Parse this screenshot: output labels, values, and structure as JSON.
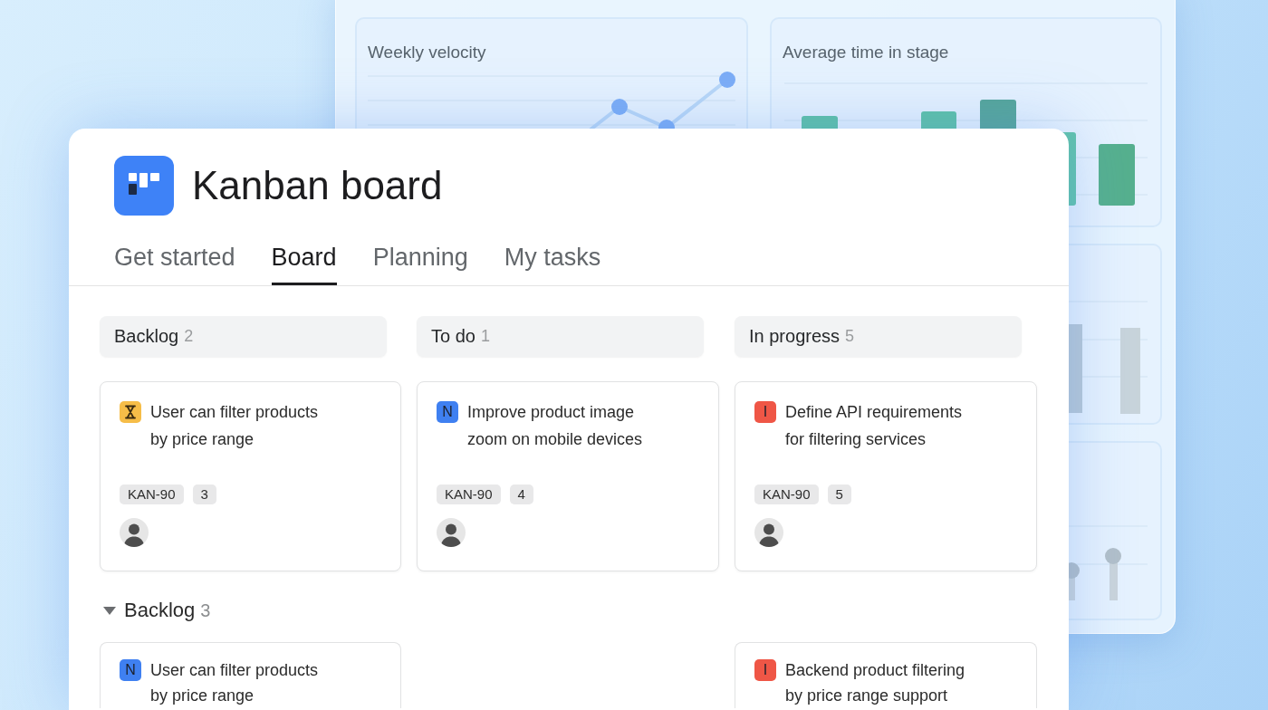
{
  "dashboard": {
    "charts": [
      {
        "kind": "line",
        "title": "Weekly velocity"
      },
      {
        "kind": "bar",
        "title": "Average time in stage"
      },
      {
        "kind": "column"
      },
      {
        "kind": "lollipop"
      }
    ]
  },
  "board": {
    "title": "Kanban board",
    "tabs": [
      {
        "label": "Get started",
        "selected": false
      },
      {
        "label": "Board",
        "selected": true
      },
      {
        "label": "Planning",
        "selected": false
      },
      {
        "label": "My tasks",
        "selected": false
      }
    ],
    "columns": [
      {
        "title": "Backlog",
        "count": "2"
      },
      {
        "title": "To do",
        "count": "1"
      },
      {
        "title": "In progress",
        "count": "5"
      }
    ],
    "lanes": [
      {
        "cells": [
          {
            "cards": [
              {
                "type": {
                  "kind": "hourglass",
                  "color": "#f6bd48"
                },
                "title": "User can filter products by price range",
                "key": "KAN-90",
                "points": "3",
                "avatar": true
              }
            ]
          },
          {
            "cards": [
              {
                "type": {
                  "kind": "letter",
                  "text": "N",
                  "color": "#3f80f1"
                },
                "title": "Improve product image zoom on mobile devices",
                "key": "KAN-90",
                "points": "4",
                "avatar": true
              }
            ]
          },
          {
            "cards": [
              {
                "type": {
                  "kind": "letter",
                  "text": "I",
                  "color": "#ef5646"
                },
                "title": "Define API requirements for filtering services",
                "key": "KAN-90",
                "points": "5",
                "avatar": true
              }
            ]
          }
        ]
      },
      {
        "title": "Backlog",
        "count": "3",
        "expanded": true,
        "cells": [
          {
            "cards": [
              {
                "type": {
                  "kind": "letter",
                  "text": "N",
                  "color": "#3f80f1"
                },
                "title": "User can filter products by price range"
              }
            ]
          },
          {},
          {
            "cards": [
              {
                "type": {
                  "kind": "letter",
                  "text": "I",
                  "color": "#ef5646"
                },
                "title": "Backend product filtering by price range support"
              }
            ]
          }
        ]
      }
    ]
  }
}
